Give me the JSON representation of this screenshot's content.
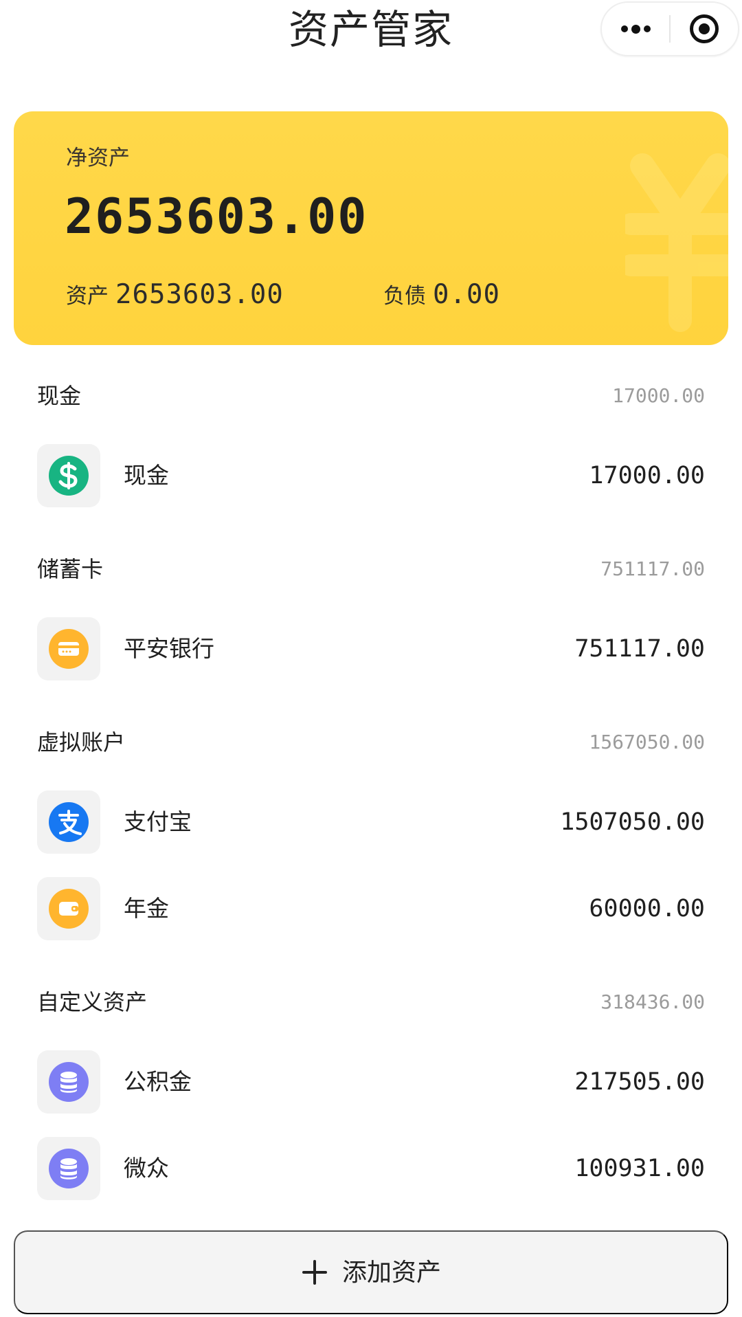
{
  "header": {
    "title": "资产管家",
    "menu_icon": "more-dots-icon",
    "target_icon": "target-icon"
  },
  "summary": {
    "net_label": "净资产",
    "net_value": "2653603.00",
    "asset_label": "资产",
    "asset_value": "2653603.00",
    "debt_label": "负债",
    "debt_value": "0.00",
    "background_color": "#ffd84a"
  },
  "sections": [
    {
      "title": "现金",
      "total": "17000.00",
      "items": [
        {
          "name": "现金",
          "amount": "17000.00",
          "icon": "dollar-icon",
          "icon_color": "#18b482"
        }
      ]
    },
    {
      "title": "储蓄卡",
      "total": "751117.00",
      "items": [
        {
          "name": "平安银行",
          "amount": "751117.00",
          "icon": "card-icon",
          "icon_color": "#ffb52e"
        }
      ]
    },
    {
      "title": "虚拟账户",
      "total": "1567050.00",
      "items": [
        {
          "name": "支付宝",
          "amount": "1507050.00",
          "icon": "alipay-icon",
          "icon_color": "#1778f2"
        },
        {
          "name": "年金",
          "amount": "60000.00",
          "icon": "wallet-icon",
          "icon_color": "#ffb52e"
        }
      ]
    },
    {
      "title": "自定义资产",
      "total": "318436.00",
      "items": [
        {
          "name": "公积金",
          "amount": "217505.00",
          "icon": "coin-stack-icon",
          "icon_color": "#7e7ef4"
        },
        {
          "name": "微众",
          "amount": "100931.00",
          "icon": "coin-stack-icon",
          "icon_color": "#7e7ef4"
        }
      ]
    }
  ],
  "actions": {
    "add_asset_label": "添加资产",
    "add_icon": "plus-icon"
  }
}
